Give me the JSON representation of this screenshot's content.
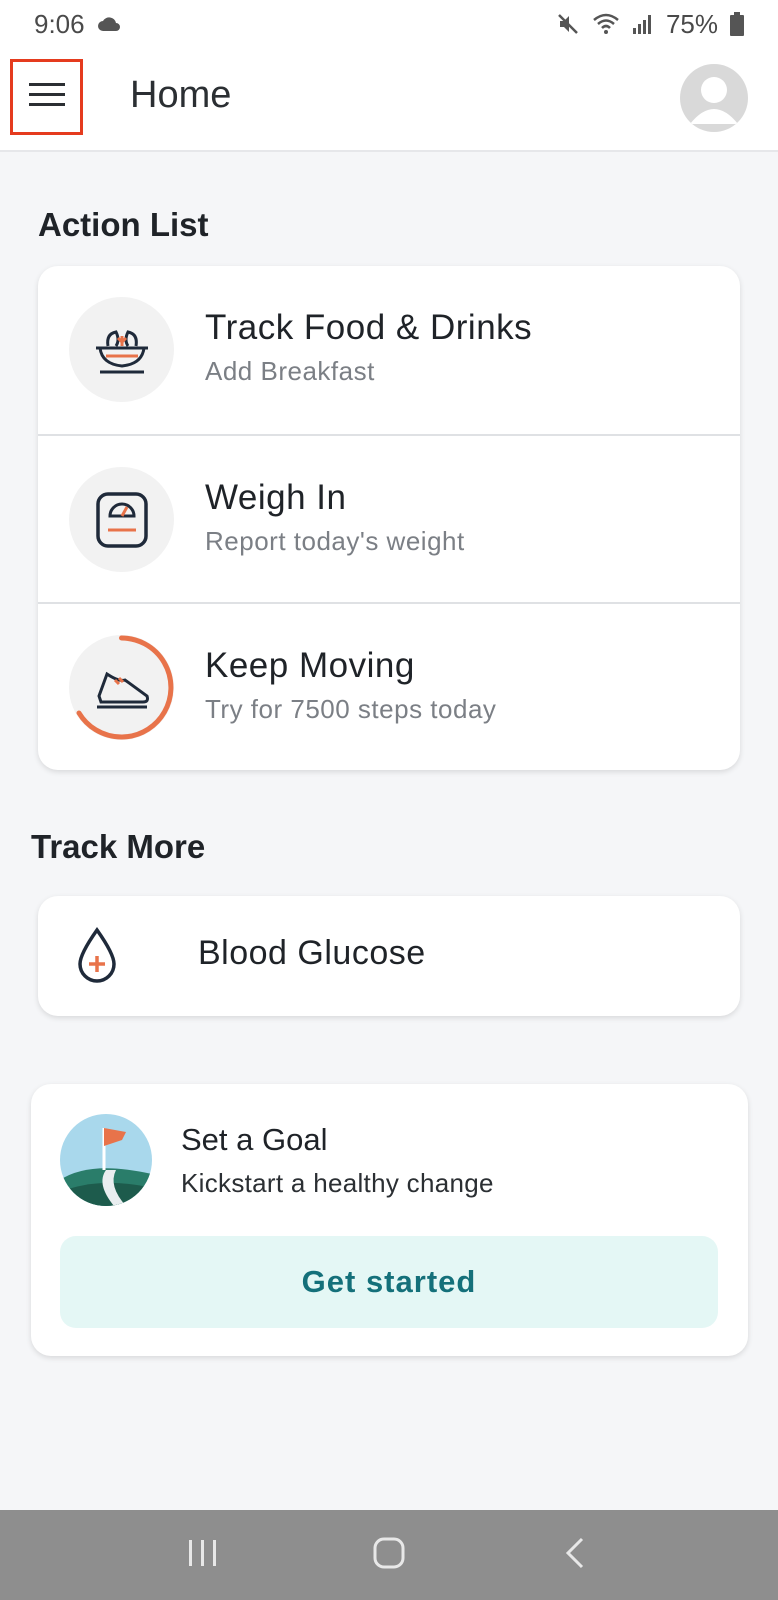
{
  "status_bar": {
    "time": "9:06",
    "battery": "75%",
    "icons": [
      "cloud-icon",
      "mute-icon",
      "wifi-icon",
      "signal-icon",
      "battery-icon"
    ]
  },
  "app_bar": {
    "title": "Home",
    "menu_icon": "hamburger-menu-icon",
    "avatar_icon": "user-avatar-icon"
  },
  "action_list": {
    "heading": "Action List",
    "items": [
      {
        "title": "Track Food & Drinks",
        "subtitle": "Add Breakfast",
        "icon": "salad-bowl-icon"
      },
      {
        "title": "Weigh In",
        "subtitle": "Report today's weight",
        "icon": "scale-icon"
      },
      {
        "title": "Keep Moving",
        "subtitle": "Try for 7500 steps today",
        "icon": "sneaker-icon"
      }
    ]
  },
  "track_more": {
    "heading": "Track More",
    "items": [
      {
        "label": "Blood Glucose",
        "icon": "blood-drop-icon"
      }
    ]
  },
  "goal": {
    "title": "Set a Goal",
    "subtitle": "Kickstart a healthy change",
    "button": "Get started",
    "icon": "goal-flag-icon"
  },
  "system_nav": {
    "icons": [
      "recent-apps-icon",
      "home-icon",
      "back-icon"
    ]
  },
  "colors": {
    "accent_orange": "#e8734a",
    "teal": "#14707a",
    "teal_light": "#e4f7f5",
    "highlight_red": "#e53b1e"
  }
}
